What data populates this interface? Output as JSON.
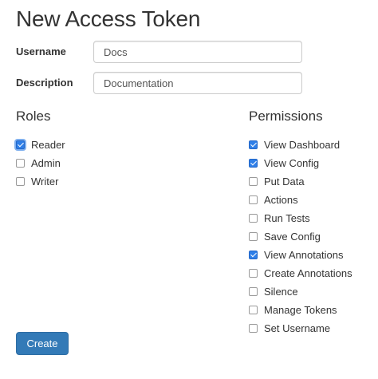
{
  "page": {
    "title": "New Access Token"
  },
  "form": {
    "username": {
      "label": "Username",
      "value": "Docs"
    },
    "description": {
      "label": "Description",
      "value": "Documentation"
    }
  },
  "roles": {
    "heading": "Roles",
    "items": [
      {
        "label": "Reader",
        "checked": true,
        "focused": true
      },
      {
        "label": "Admin",
        "checked": false
      },
      {
        "label": "Writer",
        "checked": false
      }
    ]
  },
  "permissions": {
    "heading": "Permissions",
    "items": [
      {
        "label": "View Dashboard",
        "checked": true
      },
      {
        "label": "View Config",
        "checked": true
      },
      {
        "label": "Put Data",
        "checked": false
      },
      {
        "label": "Actions",
        "checked": false
      },
      {
        "label": "Run Tests",
        "checked": false
      },
      {
        "label": "Save Config",
        "checked": false
      },
      {
        "label": "View Annotations",
        "checked": true
      },
      {
        "label": "Create Annotations",
        "checked": false
      },
      {
        "label": "Silence",
        "checked": false
      },
      {
        "label": "Manage Tokens",
        "checked": false
      },
      {
        "label": "Set Username",
        "checked": false
      }
    ]
  },
  "actions": {
    "create_label": "Create"
  },
  "colors": {
    "primary": "#337ab7",
    "checkbox_checked": "#2f7fe8",
    "text": "#333333"
  }
}
